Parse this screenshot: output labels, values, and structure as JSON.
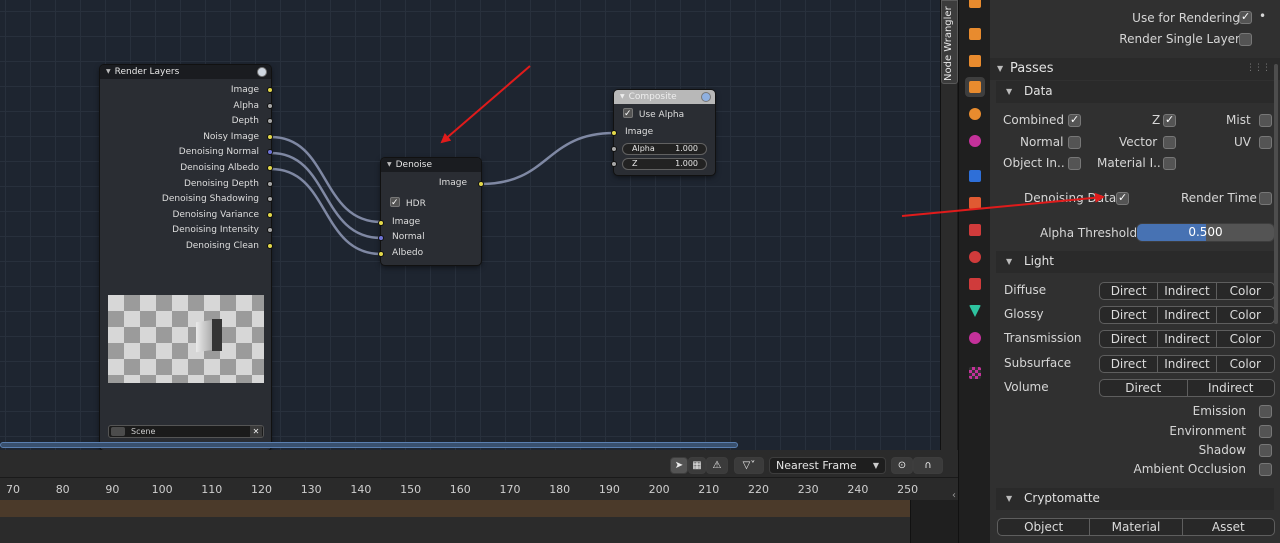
{
  "node_editor": {
    "sidebar_tab": "Node Wrangler",
    "render_layers": {
      "title": "Render Layers",
      "outputs": [
        {
          "label": "Image",
          "color": "#e3d84a"
        },
        {
          "label": "Alpha",
          "color": "#a8a8a8"
        },
        {
          "label": "Depth",
          "color": "#a8a8a8"
        },
        {
          "label": "Noisy Image",
          "color": "#e3d84a"
        },
        {
          "label": "Denoising Normal",
          "color": "#6f74d6"
        },
        {
          "label": "Denoising Albedo",
          "color": "#e3d84a"
        },
        {
          "label": "Denoising Depth",
          "color": "#a8a8a8"
        },
        {
          "label": "Denoising Shadowing",
          "color": "#a8a8a8"
        },
        {
          "label": "Denoising Variance",
          "color": "#e3d84a"
        },
        {
          "label": "Denoising Intensity",
          "color": "#a8a8a8"
        },
        {
          "label": "Denoising Clean",
          "color": "#e3d84a"
        }
      ],
      "scene_value": "Scene"
    },
    "denoise": {
      "title": "Denoise",
      "output": "Image",
      "hdr_label": "HDR",
      "hdr_checked": true,
      "inputs": [
        "Image",
        "Normal",
        "Albedo"
      ]
    },
    "composite": {
      "title": "Composite",
      "use_alpha_label": "Use Alpha",
      "use_alpha_checked": true,
      "input": "Image",
      "alpha_label": "Alpha",
      "alpha_value": "1.000",
      "z_label": "Z",
      "z_value": "1.000"
    }
  },
  "timeline": {
    "interpolation": "Nearest Frame",
    "ruler": [
      "70",
      "80",
      "90",
      "100",
      "110",
      "120",
      "130",
      "140",
      "150",
      "160",
      "170",
      "180",
      "190",
      "200",
      "210",
      "220",
      "230",
      "240",
      "250"
    ]
  },
  "properties": {
    "use_for_rendering": "Use for Rendering",
    "render_single_layer": "Render Single Layer",
    "passes_title": "Passes",
    "data_title": "Data",
    "data_checks": {
      "combined": "Combined",
      "z": "Z",
      "mist": "Mist",
      "normal": "Normal",
      "vector": "Vector",
      "uv": "UV",
      "object_index": "Object In..",
      "material_index": "Material I.."
    },
    "denoising_data": "Denoising Data",
    "render_time": "Render Time",
    "alpha_threshold_label": "Alpha Threshold",
    "alpha_threshold_value": "0.500",
    "alpha_threshold_fraction": 0.5,
    "light_title": "Light",
    "light_rows": [
      {
        "label": "Diffuse",
        "buttons": [
          "Direct",
          "Indirect",
          "Color"
        ]
      },
      {
        "label": "Glossy",
        "buttons": [
          "Direct",
          "Indirect",
          "Color"
        ]
      },
      {
        "label": "Transmission",
        "buttons": [
          "Direct",
          "Indirect",
          "Color"
        ]
      },
      {
        "label": "Subsurface",
        "buttons": [
          "Direct",
          "Indirect",
          "Color"
        ]
      },
      {
        "label": "Volume",
        "buttons": [
          "Direct",
          "Indirect"
        ]
      }
    ],
    "emission": "Emission",
    "environment": "Environment",
    "shadow": "Shadow",
    "ambient_occlusion": "Ambient Occlusion",
    "cryptomatte_title": "Cryptomatte",
    "cryptomatte_buttons": [
      "Object",
      "Material",
      "Asset"
    ]
  },
  "colors": {
    "annotation_arrow": "#e01b1b",
    "accent": "#4772b3"
  }
}
